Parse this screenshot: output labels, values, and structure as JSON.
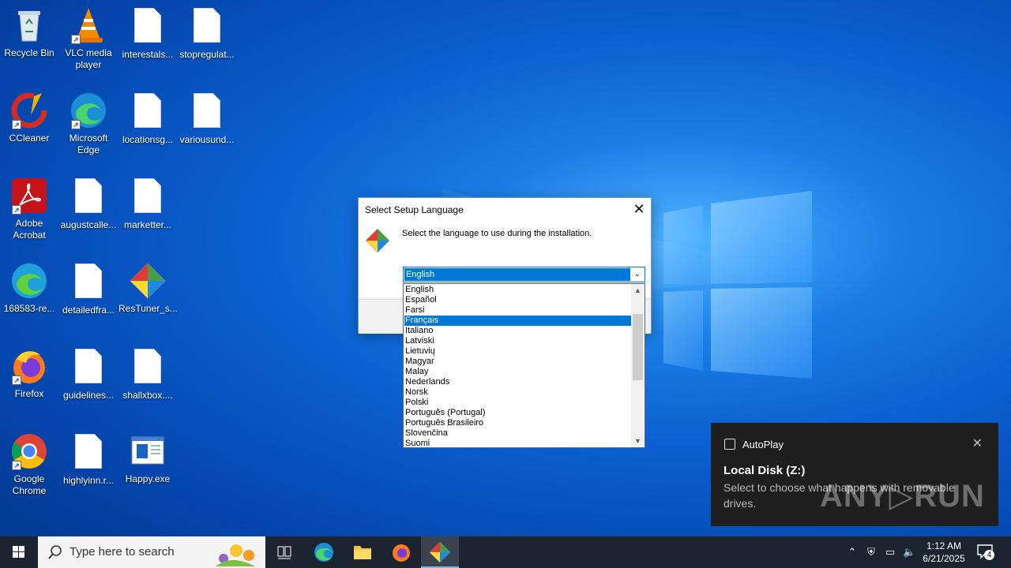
{
  "desktop": {
    "icons": [
      {
        "label": "Recycle Bin"
      },
      {
        "label": "VLC media player"
      },
      {
        "label": "interestals..."
      },
      {
        "label": "stopregulat..."
      },
      {
        "label": "CCleaner"
      },
      {
        "label": "Microsoft Edge"
      },
      {
        "label": "locationsg..."
      },
      {
        "label": "variousund..."
      },
      {
        "label": "Adobe Acrobat"
      },
      {
        "label": "augustcalle..."
      },
      {
        "label": "marketter..."
      },
      {
        "label": "168583-re..."
      },
      {
        "label": "detailedfra..."
      },
      {
        "label": "ResTuner_s..."
      },
      {
        "label": "Firefox"
      },
      {
        "label": "guidelines..."
      },
      {
        "label": "shallxbox...."
      },
      {
        "label": "Google Chrome"
      },
      {
        "label": "highlyinn.r..."
      },
      {
        "label": "Happy.exe"
      }
    ]
  },
  "dialog": {
    "title": "Select Setup Language",
    "message": "Select the language to use during the installation.",
    "close_glyph": "✕",
    "combo_value": "English",
    "languages": [
      "English",
      "Español",
      "Farsi",
      "Français",
      "Italiano",
      "Latviski",
      "Lietuvių",
      "Magyar",
      "Malay",
      "Nederlands",
      "Norsk",
      "Polski",
      "Português (Portugal)",
      "Português Brasileiro",
      "Slovenčina",
      "Suomi"
    ],
    "highlighted": "Français"
  },
  "toast": {
    "app": "AutoPlay",
    "heading": "Local Disk (Z:)",
    "text": "Select to choose what happens with removable drives.",
    "close_glyph": "✕"
  },
  "watermark": "ANY▷RUN",
  "taskbar": {
    "search_placeholder": "Type here to search",
    "time": "1:12 AM",
    "date": "6/21/2025",
    "notification_count": "4"
  },
  "colors": {
    "accent": "#0078d7",
    "taskbar": "#1c2430",
    "toast_bg": "#1f1f1f"
  }
}
